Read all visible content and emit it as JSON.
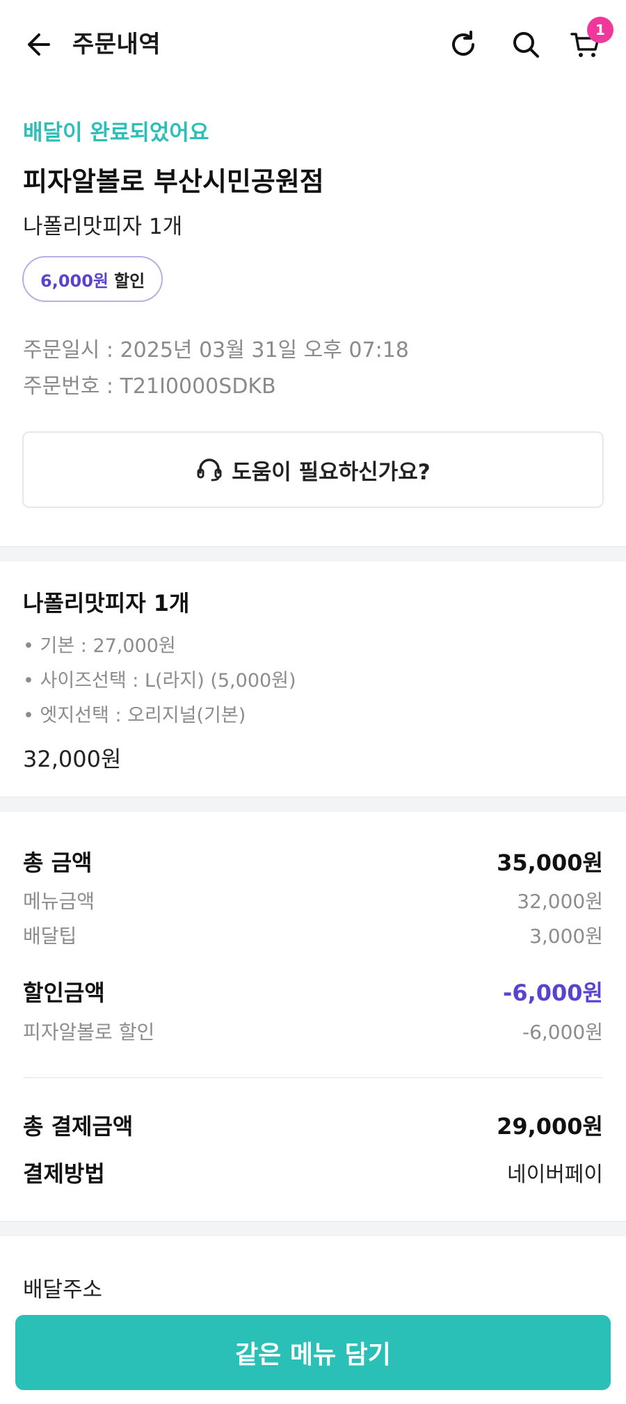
{
  "header": {
    "title": "주문내역",
    "cart_count": "1"
  },
  "order": {
    "status": "배달이 완료되었어요",
    "store_name": "피자알볼로 부산시민공원점",
    "summary": "나폴리맛피자 1개",
    "discount_amount": "6,000원",
    "discount_label": "할인",
    "order_date": "주문일시 : 2025년 03월 31일 오후 07:18",
    "order_number": "주문번호 : T21I0000SDKB",
    "help_label": "도움이 필요하신가요?"
  },
  "menu": {
    "name": "나폴리맛피자 1개",
    "options": [
      "• 기본 : 27,000원",
      "• 사이즈선택 : L(라지) (5,000원)",
      "• 엣지선택 : 오리지널(기본)"
    ],
    "price": "32,000원"
  },
  "payment": {
    "total_label": "총 금액",
    "total_value": "35,000원",
    "menu_label": "메뉴금액",
    "menu_value": "32,000원",
    "tip_label": "배달팁",
    "tip_value": "3,000원",
    "discount_label": "할인금액",
    "discount_value": "-6,000원",
    "store_discount_label": "피자알볼로 할인",
    "store_discount_value": "-6,000원",
    "final_label": "총 결제금액",
    "final_value": "29,000원",
    "method_label": "결제방법",
    "method_value": "네이버페이"
  },
  "address": {
    "label": "배달주소"
  },
  "cta": {
    "label": "같은 메뉴 담기"
  },
  "colors": {
    "accent": "#2bc0b7",
    "discount": "#5b43cf",
    "badge": "#f0379b"
  }
}
